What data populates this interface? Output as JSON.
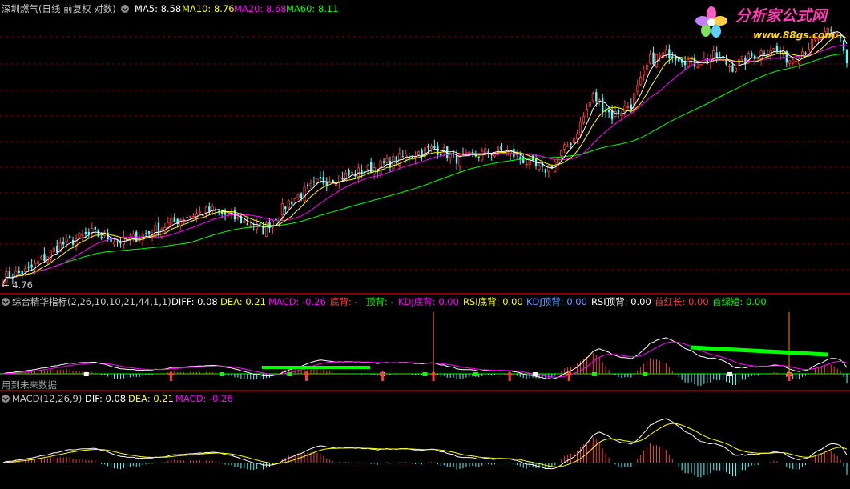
{
  "colors": {
    "up": "#ff3c3c",
    "down": "#54ffff",
    "ma5": "#ffffff",
    "ma10": "#ffff00",
    "ma20": "#ff00ff",
    "ma60": "#00ff00",
    "grid": "#800000",
    "sep": "#b40000",
    "label": "#c8c8c8",
    "dif": "#ffffff",
    "dea": "#ffff00",
    "macd": "#ff00ff",
    "bottom_green": "#00ff00",
    "kdj": "#5aa0ff",
    "orange": "#ff8000"
  },
  "price_header": {
    "title": "深圳燃气(日线 前复权 对数)",
    "ma5": "MA5: 8.58",
    "ma10": "MA10: 8.76",
    "ma20": "MA20: 8.68",
    "ma60": "MA60: 8.11"
  },
  "watermark": {
    "main": "分析家公式网",
    "url": "www.88gs.com"
  },
  "price_low_label": "← 4.76",
  "ind1_header": {
    "title": "综合精华指标(2,26,10,10,21,44,1,1)",
    "diff": "DIFF: 0.08",
    "dea": "DEA: 0.21",
    "macd": "MACD: -0.26",
    "bottom_div": "底背: -",
    "top_div": "顶背: -",
    "kdj_bottom": "KDJ底背: 0.00",
    "rsi_bottom": "RSI底背: 0.00",
    "kdj_top": "KDJ顶背: 0.00",
    "rsi_top": "RSI顶背: 0.00",
    "first_red": "首红长: 0.00",
    "first_green": "首绿短: 0.00"
  },
  "future_data_note": "用到未来数据",
  "ind2_header": {
    "title": "MACD(12,26,9)",
    "dif": "DIF: 0.08",
    "dea": "DEA: 0.21",
    "macd": "MACD: -0.26"
  },
  "chart_data": {
    "type": "line",
    "title": "深圳燃气(日线 前复权 对数)",
    "scale": "log",
    "price_range": [
      4.7,
      10.5
    ],
    "low_marker": 4.76,
    "close_anchors": [
      [
        0,
        4.8
      ],
      [
        8,
        4.9
      ],
      [
        18,
        5.3
      ],
      [
        28,
        5.5
      ],
      [
        38,
        5.35
      ],
      [
        48,
        5.55
      ],
      [
        58,
        5.8
      ],
      [
        66,
        5.9
      ],
      [
        76,
        5.7
      ],
      [
        82,
        5.55
      ],
      [
        90,
        6.05
      ],
      [
        100,
        6.45
      ],
      [
        110,
        6.6
      ],
      [
        120,
        6.8
      ],
      [
        128,
        7.0
      ],
      [
        136,
        7.15
      ],
      [
        144,
        6.9
      ],
      [
        152,
        7.05
      ],
      [
        158,
        7.1
      ],
      [
        164,
        6.9
      ],
      [
        170,
        6.65
      ],
      [
        174,
        6.85
      ],
      [
        180,
        7.4
      ],
      [
        186,
        8.4
      ],
      [
        192,
        7.9
      ],
      [
        198,
        8.2
      ],
      [
        204,
        9.4
      ],
      [
        210,
        9.6
      ],
      [
        218,
        9.3
      ],
      [
        224,
        9.5
      ],
      [
        230,
        9.2
      ],
      [
        236,
        9.5
      ],
      [
        242,
        9.75
      ],
      [
        248,
        9.4
      ],
      [
        254,
        9.8
      ],
      [
        260,
        10.2
      ],
      [
        264,
        10.1
      ],
      [
        266,
        9.3
      ]
    ],
    "ma_last": {
      "MA5": 8.58,
      "MA10": 8.76,
      "MA20": 8.68,
      "MA60": 8.11
    },
    "indicator_last": {
      "DIFF": 0.08,
      "DEA": 0.21,
      "MACD": -0.26
    }
  }
}
